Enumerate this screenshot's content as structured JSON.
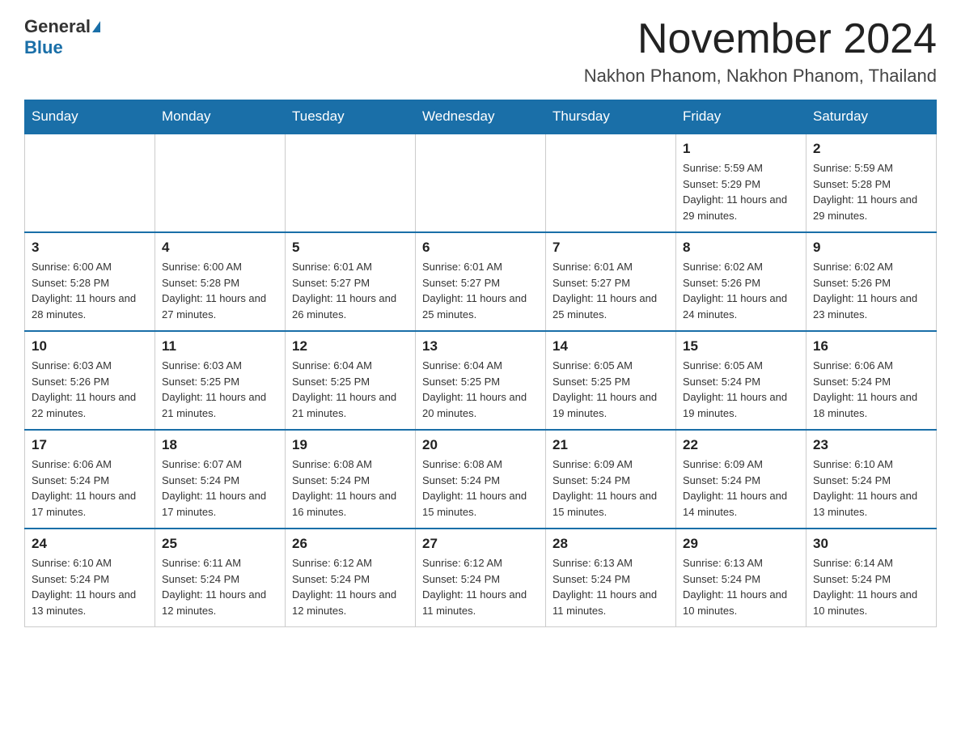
{
  "header": {
    "logo_general": "General",
    "logo_blue": "Blue",
    "month_title": "November 2024",
    "location": "Nakhon Phanom, Nakhon Phanom, Thailand"
  },
  "weekdays": [
    "Sunday",
    "Monday",
    "Tuesday",
    "Wednesday",
    "Thursday",
    "Friday",
    "Saturday"
  ],
  "weeks": [
    [
      {
        "day": "",
        "info": ""
      },
      {
        "day": "",
        "info": ""
      },
      {
        "day": "",
        "info": ""
      },
      {
        "day": "",
        "info": ""
      },
      {
        "day": "",
        "info": ""
      },
      {
        "day": "1",
        "info": "Sunrise: 5:59 AM\nSunset: 5:29 PM\nDaylight: 11 hours and 29 minutes."
      },
      {
        "day": "2",
        "info": "Sunrise: 5:59 AM\nSunset: 5:28 PM\nDaylight: 11 hours and 29 minutes."
      }
    ],
    [
      {
        "day": "3",
        "info": "Sunrise: 6:00 AM\nSunset: 5:28 PM\nDaylight: 11 hours and 28 minutes."
      },
      {
        "day": "4",
        "info": "Sunrise: 6:00 AM\nSunset: 5:28 PM\nDaylight: 11 hours and 27 minutes."
      },
      {
        "day": "5",
        "info": "Sunrise: 6:01 AM\nSunset: 5:27 PM\nDaylight: 11 hours and 26 minutes."
      },
      {
        "day": "6",
        "info": "Sunrise: 6:01 AM\nSunset: 5:27 PM\nDaylight: 11 hours and 25 minutes."
      },
      {
        "day": "7",
        "info": "Sunrise: 6:01 AM\nSunset: 5:27 PM\nDaylight: 11 hours and 25 minutes."
      },
      {
        "day": "8",
        "info": "Sunrise: 6:02 AM\nSunset: 5:26 PM\nDaylight: 11 hours and 24 minutes."
      },
      {
        "day": "9",
        "info": "Sunrise: 6:02 AM\nSunset: 5:26 PM\nDaylight: 11 hours and 23 minutes."
      }
    ],
    [
      {
        "day": "10",
        "info": "Sunrise: 6:03 AM\nSunset: 5:26 PM\nDaylight: 11 hours and 22 minutes."
      },
      {
        "day": "11",
        "info": "Sunrise: 6:03 AM\nSunset: 5:25 PM\nDaylight: 11 hours and 21 minutes."
      },
      {
        "day": "12",
        "info": "Sunrise: 6:04 AM\nSunset: 5:25 PM\nDaylight: 11 hours and 21 minutes."
      },
      {
        "day": "13",
        "info": "Sunrise: 6:04 AM\nSunset: 5:25 PM\nDaylight: 11 hours and 20 minutes."
      },
      {
        "day": "14",
        "info": "Sunrise: 6:05 AM\nSunset: 5:25 PM\nDaylight: 11 hours and 19 minutes."
      },
      {
        "day": "15",
        "info": "Sunrise: 6:05 AM\nSunset: 5:24 PM\nDaylight: 11 hours and 19 minutes."
      },
      {
        "day": "16",
        "info": "Sunrise: 6:06 AM\nSunset: 5:24 PM\nDaylight: 11 hours and 18 minutes."
      }
    ],
    [
      {
        "day": "17",
        "info": "Sunrise: 6:06 AM\nSunset: 5:24 PM\nDaylight: 11 hours and 17 minutes."
      },
      {
        "day": "18",
        "info": "Sunrise: 6:07 AM\nSunset: 5:24 PM\nDaylight: 11 hours and 17 minutes."
      },
      {
        "day": "19",
        "info": "Sunrise: 6:08 AM\nSunset: 5:24 PM\nDaylight: 11 hours and 16 minutes."
      },
      {
        "day": "20",
        "info": "Sunrise: 6:08 AM\nSunset: 5:24 PM\nDaylight: 11 hours and 15 minutes."
      },
      {
        "day": "21",
        "info": "Sunrise: 6:09 AM\nSunset: 5:24 PM\nDaylight: 11 hours and 15 minutes."
      },
      {
        "day": "22",
        "info": "Sunrise: 6:09 AM\nSunset: 5:24 PM\nDaylight: 11 hours and 14 minutes."
      },
      {
        "day": "23",
        "info": "Sunrise: 6:10 AM\nSunset: 5:24 PM\nDaylight: 11 hours and 13 minutes."
      }
    ],
    [
      {
        "day": "24",
        "info": "Sunrise: 6:10 AM\nSunset: 5:24 PM\nDaylight: 11 hours and 13 minutes."
      },
      {
        "day": "25",
        "info": "Sunrise: 6:11 AM\nSunset: 5:24 PM\nDaylight: 11 hours and 12 minutes."
      },
      {
        "day": "26",
        "info": "Sunrise: 6:12 AM\nSunset: 5:24 PM\nDaylight: 11 hours and 12 minutes."
      },
      {
        "day": "27",
        "info": "Sunrise: 6:12 AM\nSunset: 5:24 PM\nDaylight: 11 hours and 11 minutes."
      },
      {
        "day": "28",
        "info": "Sunrise: 6:13 AM\nSunset: 5:24 PM\nDaylight: 11 hours and 11 minutes."
      },
      {
        "day": "29",
        "info": "Sunrise: 6:13 AM\nSunset: 5:24 PM\nDaylight: 11 hours and 10 minutes."
      },
      {
        "day": "30",
        "info": "Sunrise: 6:14 AM\nSunset: 5:24 PM\nDaylight: 11 hours and 10 minutes."
      }
    ]
  ]
}
